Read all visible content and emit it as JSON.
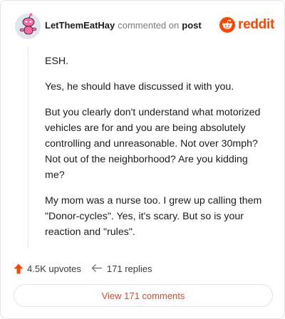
{
  "comment": {
    "username": "LetThemEatHay",
    "action_text": "commented on",
    "post_link": "post",
    "brand": "reddit",
    "brand_color": "#ff4500",
    "paragraphs": [
      "ESH.",
      "Yes, he should have discussed it with you.",
      "But you clearly don't understand what motorized vehicles are for and you are being absolutely controlling and unreasonable. Not over 30mph? Not out of the neighborhood? Are you kidding me?",
      "My mom was a nurse too. I grew up calling them \"Donor-cycles\". Yes, it's scary. But so is your reaction and \"rules\"."
    ]
  },
  "actions": {
    "upvotes": "4.5K upvotes",
    "replies": "171 replies",
    "upvote_icon": "upvote-arrow-icon",
    "reply_icon": "reply-arrow-icon"
  },
  "footer": {
    "view_comments": "View 171 comments"
  }
}
